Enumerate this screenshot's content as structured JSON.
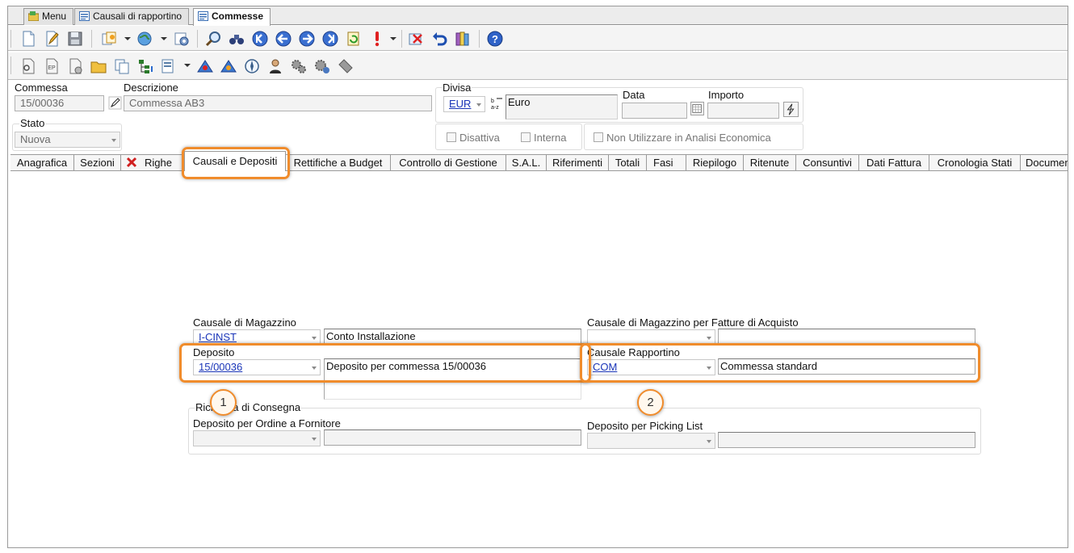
{
  "window_tabs": [
    {
      "label": "Menu"
    },
    {
      "label": "Causali di rapportino"
    },
    {
      "label": "Commesse"
    }
  ],
  "header": {
    "commessa_label": "Commessa",
    "commessa_value": "15/00036",
    "descrizione_label": "Descrizione",
    "descrizione_value": "Commessa AB3",
    "stato_label": "Stato",
    "stato_value": "Nuova",
    "divisa_label": "Divisa",
    "divisa_code": "EUR",
    "divisa_desc": "Euro",
    "data_label": "Data",
    "importo_label": "Importo",
    "disattiva_label": "Disattiva",
    "interna_label": "Interna",
    "non_utilizzare_label": "Non Utilizzare in Analisi Economica"
  },
  "tabs": [
    {
      "label": "Anagrafica"
    },
    {
      "label": "Sezioni"
    },
    {
      "label": "Righe"
    },
    {
      "label": "Causali e Depositi"
    },
    {
      "label": "Rettifiche a Budget"
    },
    {
      "label": "Controllo di Gestione"
    },
    {
      "label": "S.A.L."
    },
    {
      "label": "Riferimenti"
    },
    {
      "label": "Totali"
    },
    {
      "label": "Fasi"
    },
    {
      "label": "Riepilogo"
    },
    {
      "label": "Ritenute"
    },
    {
      "label": "Consuntivi"
    },
    {
      "label": "Dati Fattura"
    },
    {
      "label": "Cronologia Stati"
    },
    {
      "label": "Documen"
    }
  ],
  "form": {
    "causale_magazzino_label": "Causale di Magazzino",
    "causale_magazzino_code": "I-CINST",
    "causale_magazzino_desc": "Conto Installazione",
    "causale_fatture_label": "Causale di Magazzino per Fatture di Acquisto",
    "deposito_label": "Deposito",
    "deposito_code": "15/00036",
    "deposito_desc": "Deposito per commessa 15/00036",
    "causale_rapportino_label": "Causale Rapportino",
    "causale_rapportino_code": "COM",
    "causale_rapportino_desc": "Commessa standard",
    "richiesta_label": "Richiesta di Consegna",
    "deposito_ordine_label": "Deposito per Ordine a Fornitore",
    "deposito_picking_label": "Deposito per Picking List"
  },
  "callouts": [
    "1",
    "2"
  ],
  "colors": {
    "highlight": "#f08c2c",
    "link": "#1a35b8"
  }
}
